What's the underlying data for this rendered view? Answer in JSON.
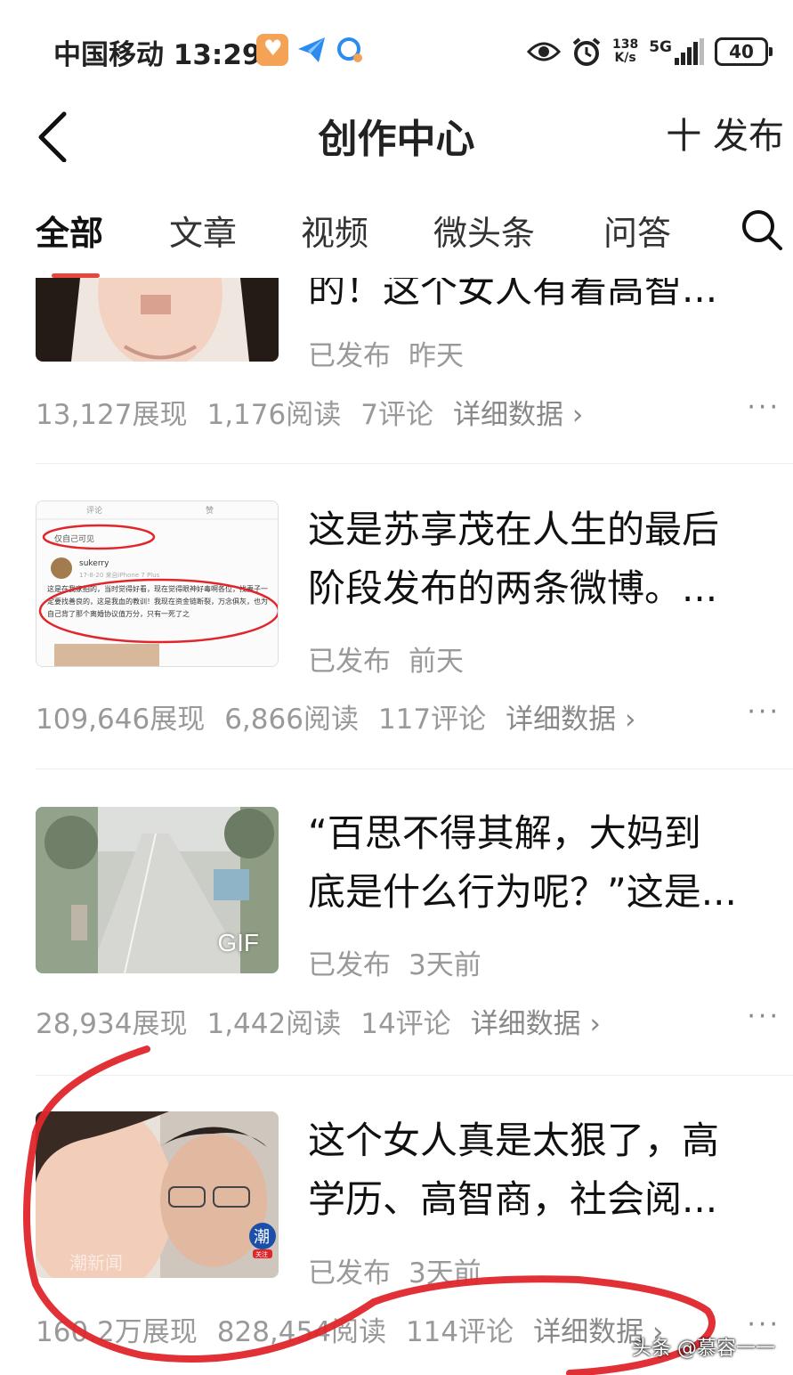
{
  "status": {
    "carrier_time": "中国移动 13:29",
    "net_speed_value": "138",
    "net_speed_unit": "K/s",
    "network": "5G",
    "battery": "40"
  },
  "nav": {
    "title": "创作中心",
    "publish": "十 发布"
  },
  "tabs": [
    {
      "label": "全部",
      "active": true
    },
    {
      "label": "文章"
    },
    {
      "label": "视频"
    },
    {
      "label": "微头条"
    },
    {
      "label": "问答"
    }
  ],
  "articles": [
    {
      "title_lines": [
        "的！这个女人有着高智..."
      ],
      "status": "已发布",
      "time": "昨天",
      "impressions": "13,127展现",
      "reads": "1,176阅读",
      "comments": "7评论",
      "detail": "详细数据 ›",
      "thumb": "woman-portrait"
    },
    {
      "title_lines": [
        "这是苏享茂在人生的最后",
        "阶段发布的两条微博。..."
      ],
      "status": "已发布",
      "time": "前天",
      "impressions": "109,646展现",
      "reads": "6,866阅读",
      "comments": "117评论",
      "detail": "详细数据 ›",
      "thumb": "weibo-screenshot",
      "thumb_text": {
        "comment": "评论",
        "like": "赞",
        "visibility": "仅自己可见",
        "username": "sukerry",
        "meta": "17-8-20  来自iPhone 7 Plus",
        "body": "这是在我家拍的，当时觉得好看，现在觉得眼神好毒啊各位，找妻子一定要找善良的，这是我血的教训！我现在资金链断裂，万念俱灰，也为自己背了那个离婚协议值万分，只有一死了之"
      }
    },
    {
      "title_lines": [
        "“百思不得其解，大妈到",
        "底是什么行为呢？”这是..."
      ],
      "status": "已发布",
      "time": "3天前",
      "impressions": "28,934展现",
      "reads": "1,442阅读",
      "comments": "14评论",
      "detail": "详细数据 ›",
      "thumb": "street-gif",
      "badge": "GIF"
    },
    {
      "title_lines": [
        "这个女人真是太狠了，高",
        "学历、高智商，社会阅..."
      ],
      "status": "已发布",
      "time": "3天前",
      "impressions": "160.2万展现",
      "reads": "828,454阅读",
      "comments": "114评论",
      "detail": "详细数据 ›",
      "thumb": "couple-photo",
      "thumb_logo": "潮",
      "thumb_follow": "关注",
      "thumb_corner": "潮新闻"
    }
  ],
  "more_label": "···",
  "watermark": "头条 @慕容一一",
  "colors": {
    "accent": "#e8453c",
    "annotation_red": "#e0262b",
    "muted_text": "#999999"
  }
}
